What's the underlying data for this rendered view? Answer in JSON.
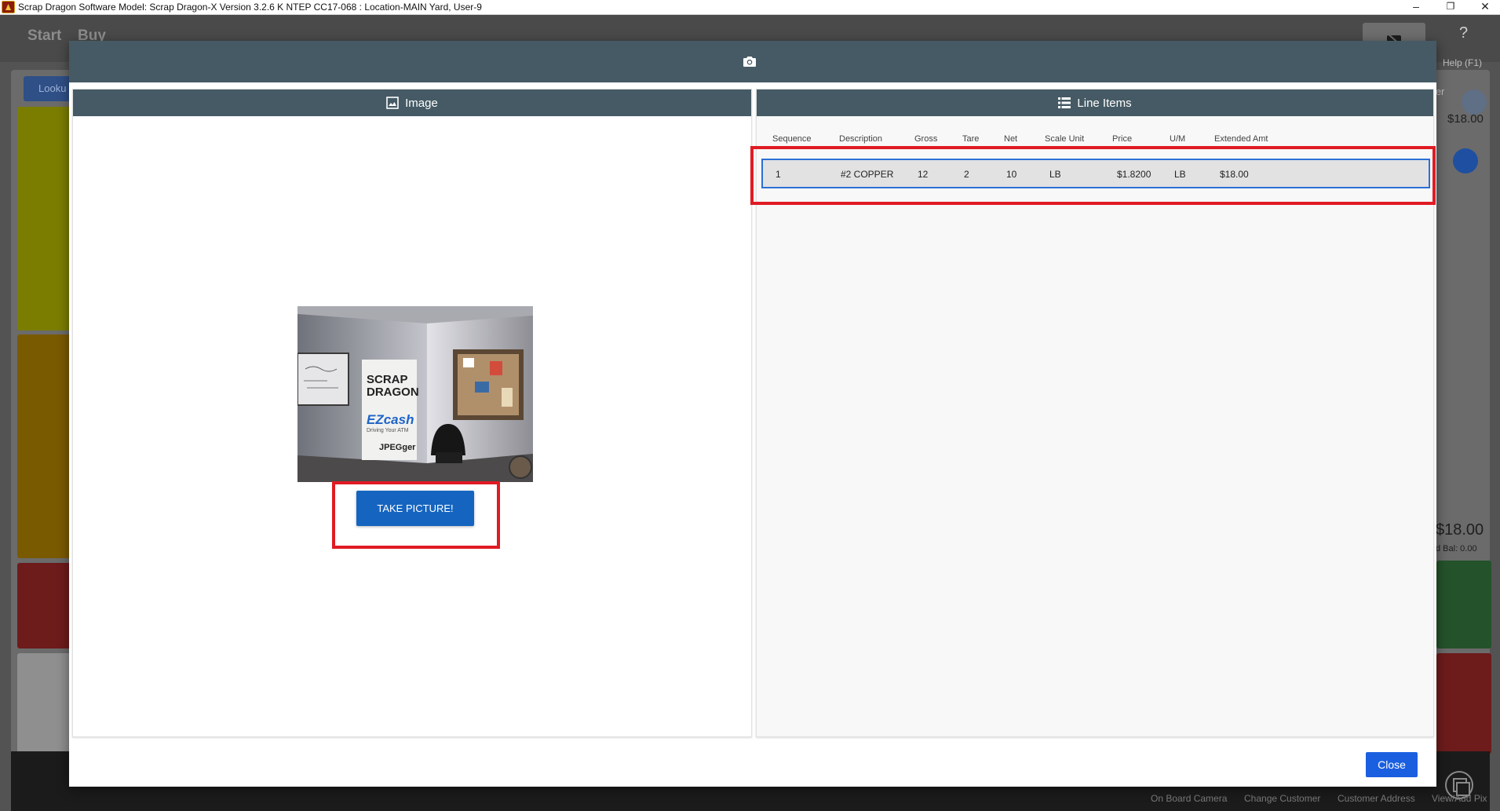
{
  "window": {
    "title": "Scrap Dragon Software Model: Scrap Dragon-X Version 3.2.6 K NTEP CC17-068 : Location-MAIN Yard, User-9",
    "minimize_glyph": "–",
    "restore_glyph": "❐",
    "close_glyph": "✕"
  },
  "background": {
    "nav": [
      "Start",
      "Buy"
    ],
    "lookup_label": "Looku",
    "help_label": "Help (F1)",
    "help_glyph": "?",
    "customer_partial": "mer",
    "amount_top": "$18.00",
    "amount_big": "$18.00",
    "balance_partial": "d Bal: 0.00",
    "footer_links": [
      "On Board Camera",
      "Change Customer",
      "Customer Address",
      "View/Add Pix"
    ]
  },
  "modal": {
    "header_icon": "camera-icon",
    "image_pane": {
      "title": "Image",
      "icon": "image-icon",
      "take_picture_label": "TAKE PICTURE!"
    },
    "line_items_pane": {
      "title": "Line Items",
      "icon": "list-icon",
      "columns": [
        "Sequence",
        "Description",
        "Gross",
        "Tare",
        "Net",
        "Scale Unit",
        "Price",
        "U/M",
        "Extended Amt"
      ],
      "rows": [
        {
          "sequence": "1",
          "description": "#2 COPPER",
          "gross": "12",
          "tare": "2",
          "net": "10",
          "scale_unit": "LB",
          "price": "$1.8200",
          "um": "LB",
          "extended_amt": "$18.00"
        }
      ]
    },
    "close_label": "Close"
  },
  "colors": {
    "header_bg": "#455a64",
    "primary_button": "#1565c0",
    "close_button": "#1a5fe0",
    "highlight_outline": "#e01b24",
    "row_selection": "#2d6fd6"
  },
  "photo": {
    "poster_lines": [
      "SCRAP",
      "DRAGON",
      "EZcash",
      "Driving Your ATM",
      "JPEGger"
    ]
  }
}
